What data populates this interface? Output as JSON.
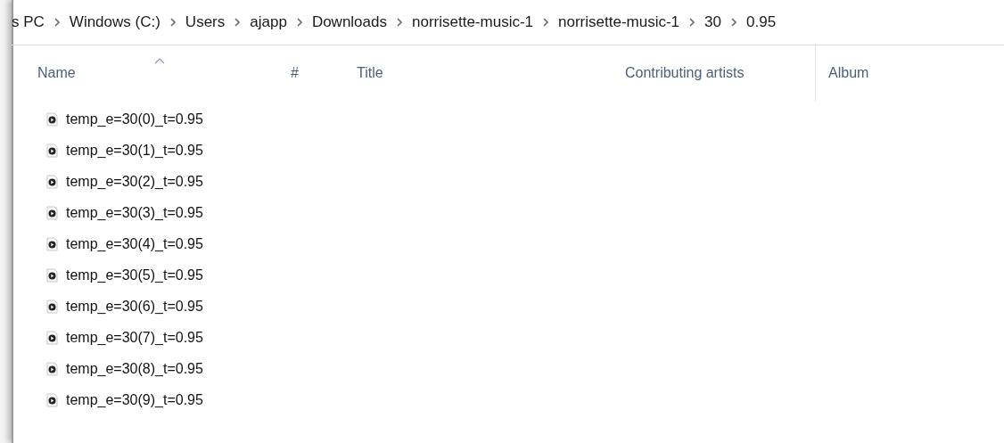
{
  "breadcrumb": [
    "s PC",
    "Windows (C:)",
    "Users",
    "ajapp",
    "Downloads",
    "norrisette-music-1",
    "norrisette-music-1",
    "30",
    "0.95"
  ],
  "columns": [
    {
      "label": "Name",
      "sorted": true
    },
    {
      "label": "#",
      "sorted": false
    },
    {
      "label": "Title",
      "sorted": false
    },
    {
      "label": "Contributing artists",
      "sorted": false
    },
    {
      "label": "Album",
      "sorted": false
    }
  ],
  "files": [
    {
      "name": "temp_e=30(0)_t=0.95"
    },
    {
      "name": "temp_e=30(1)_t=0.95"
    },
    {
      "name": "temp_e=30(2)_t=0.95"
    },
    {
      "name": "temp_e=30(3)_t=0.95"
    },
    {
      "name": "temp_e=30(4)_t=0.95"
    },
    {
      "name": "temp_e=30(5)_t=0.95"
    },
    {
      "name": "temp_e=30(6)_t=0.95"
    },
    {
      "name": "temp_e=30(7)_t=0.95"
    },
    {
      "name": "temp_e=30(8)_t=0.95"
    },
    {
      "name": "temp_e=30(9)_t=0.95"
    }
  ]
}
